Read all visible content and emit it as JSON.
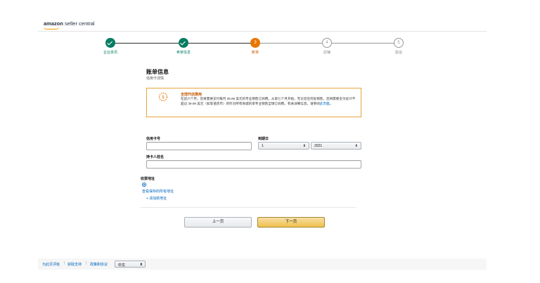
{
  "header": {
    "logo_brand": "amazon",
    "logo_suffix": "seller central"
  },
  "steps": [
    {
      "label": "企业资讯",
      "state": "done",
      "number": ""
    },
    {
      "label": "卖家信息",
      "state": "done",
      "number": ""
    },
    {
      "label": "账单",
      "state": "active",
      "number": "3"
    },
    {
      "label": "店铺",
      "state": "todo",
      "number": "4"
    },
    {
      "label": "验证",
      "state": "todo",
      "number": "5"
    }
  ],
  "page": {
    "title": "账单信息",
    "subtitle": "信用卡详情"
  },
  "alert": {
    "title": "全球开店费用",
    "text": "在前六个月，您将需要支付每月 39.99 美元的专业销售订阅费。从第七个月开始，无论您在何处销售，您将需要支付总计不超过 39.99 美元（如等值货币）的针对所有商城的单专业销售全球订阅费。有关详细信息，请参阅",
    "link": "此页面",
    "end": "。"
  },
  "form": {
    "card_label": "信用卡号",
    "card_value": "",
    "expiry_label": "到期日",
    "month_value": "1",
    "year_value": "2021",
    "holder_label": "持卡人姓名",
    "holder_value": "",
    "address_label": "收票地址",
    "show_addresses_link": "查看保存的所有地址",
    "add_address_link": "+ 添加新地址"
  },
  "buttons": {
    "prev": "上一页",
    "next": "下一页"
  },
  "footer": {
    "help": "为此页评级",
    "support": "获取支持",
    "policies": "政策和协议",
    "language": "中文"
  },
  "colors": {
    "done": "#067d62",
    "active": "#e77600",
    "alert_border": "#e8a33b",
    "link": "#0066c0"
  }
}
